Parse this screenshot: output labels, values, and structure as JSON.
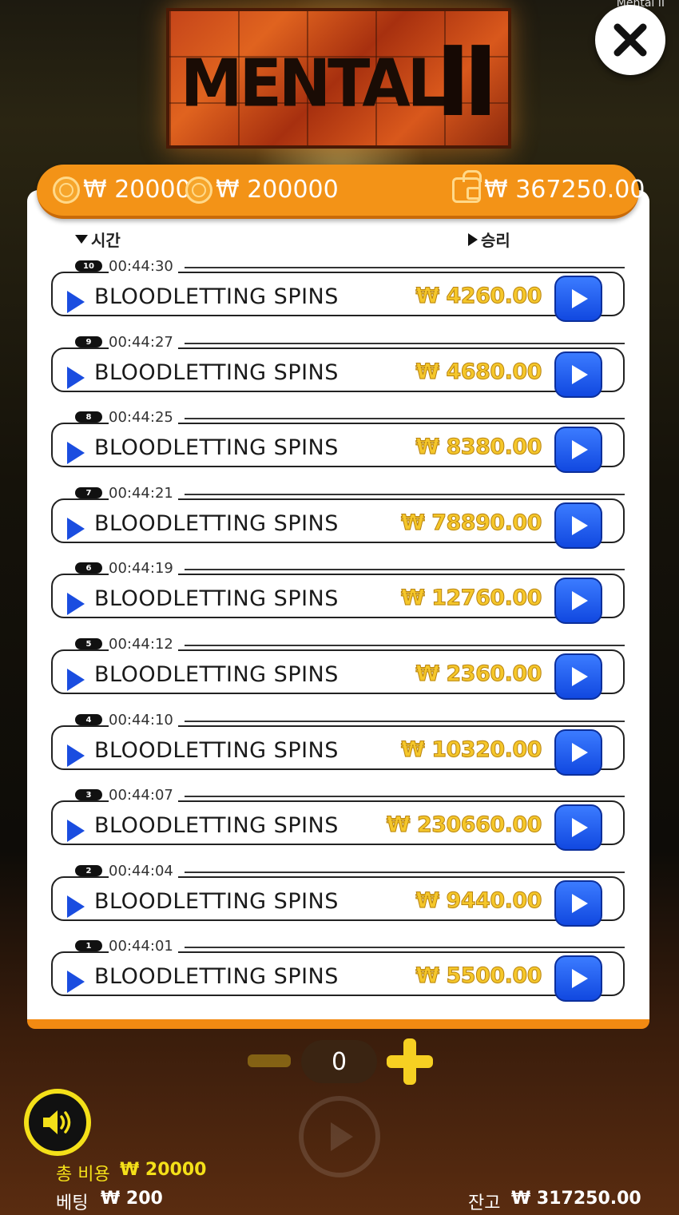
{
  "window": {
    "title": "Mental II"
  },
  "logo": {
    "text": "MENTAL",
    "numeral": "II"
  },
  "balance_bar": {
    "bet_amount": "₩ 20000",
    "max_amount": "₩ 200000",
    "wallet_amount": "₩ 367250.00"
  },
  "columns": {
    "time": "시간",
    "win": "승리"
  },
  "history": [
    {
      "num": "10",
      "time": "00:44:30",
      "title": "BLOODLETTING SPINS",
      "amount": "₩ 4260.00"
    },
    {
      "num": "9",
      "time": "00:44:27",
      "title": "BLOODLETTING SPINS",
      "amount": "₩ 4680.00"
    },
    {
      "num": "8",
      "time": "00:44:25",
      "title": "BLOODLETTING SPINS",
      "amount": "₩ 8380.00"
    },
    {
      "num": "7",
      "time": "00:44:21",
      "title": "BLOODLETTING SPINS",
      "amount": "₩ 78890.00"
    },
    {
      "num": "6",
      "time": "00:44:19",
      "title": "BLOODLETTING SPINS",
      "amount": "₩ 12760.00"
    },
    {
      "num": "5",
      "time": "00:44:12",
      "title": "BLOODLETTING SPINS",
      "amount": "₩ 2360.00"
    },
    {
      "num": "4",
      "time": "00:44:10",
      "title": "BLOODLETTING SPINS",
      "amount": "₩ 10320.00"
    },
    {
      "num": "3",
      "time": "00:44:07",
      "title": "BLOODLETTING SPINS",
      "amount": "₩ 230660.00"
    },
    {
      "num": "2",
      "time": "00:44:04",
      "title": "BLOODLETTING SPINS",
      "amount": "₩ 9440.00"
    },
    {
      "num": "1",
      "time": "00:44:01",
      "title": "BLOODLETTING SPINS",
      "amount": "₩ 5500.00"
    }
  ],
  "controls": {
    "count": "0"
  },
  "footer": {
    "total_cost_label": "총 비용",
    "total_cost_value": "₩ 20000",
    "bet_label": "베팅",
    "bet_value": "₩ 200",
    "balance_label": "잔고",
    "balance_value": "₩ 317250.00"
  },
  "colors": {
    "accent_orange": "#f39317",
    "play_blue": "#1a4de0",
    "amount_gold": "#f5c72a",
    "sound_yellow": "#f4e019"
  },
  "icons": [
    "close-icon",
    "coin-icon",
    "wallet-icon",
    "play-icon",
    "sound-icon",
    "minus-icon",
    "plus-icon",
    "spin-icon"
  ]
}
